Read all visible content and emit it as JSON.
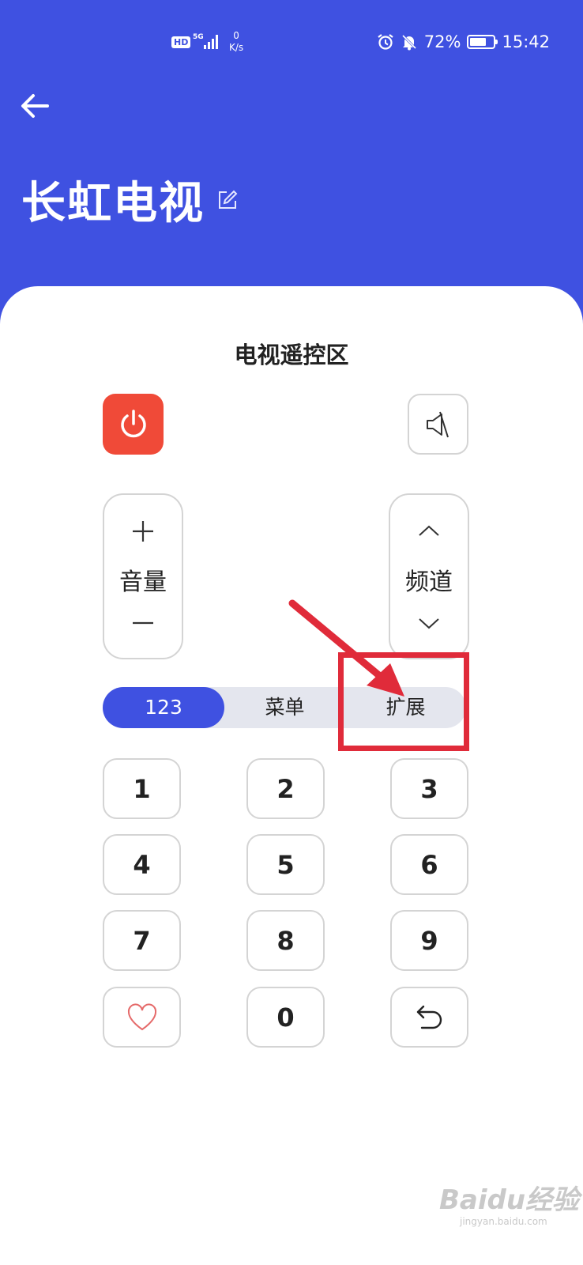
{
  "status_bar": {
    "hd": "HD",
    "network": "5G",
    "speed_value": "0",
    "speed_unit": "K/s",
    "battery_percent": "72%",
    "battery_level": 0.72,
    "time": "15:42"
  },
  "header": {
    "title": "长虹电视"
  },
  "remote": {
    "section_title": "电视遥控区",
    "volume_label": "音量",
    "channel_label": "频道",
    "tabs": [
      {
        "label": "123",
        "active": true
      },
      {
        "label": "菜单",
        "active": false
      },
      {
        "label": "扩展",
        "active": false
      }
    ],
    "keys": [
      "1",
      "2",
      "3",
      "4",
      "5",
      "6",
      "7",
      "8",
      "9",
      "0"
    ]
  },
  "colors": {
    "header_bg": "#3f51e1",
    "power": "#f04a38",
    "active_tab": "#3f51e1",
    "annotation": "#e02b3a"
  },
  "icons": {
    "back": "back-arrow-icon",
    "edit": "edit-icon",
    "power": "power-icon",
    "mute": "mute-icon",
    "favorite": "heart-icon",
    "return": "return-icon"
  },
  "watermark": {
    "text": "Baidu经验",
    "sub": "jingyan.baidu.com"
  }
}
